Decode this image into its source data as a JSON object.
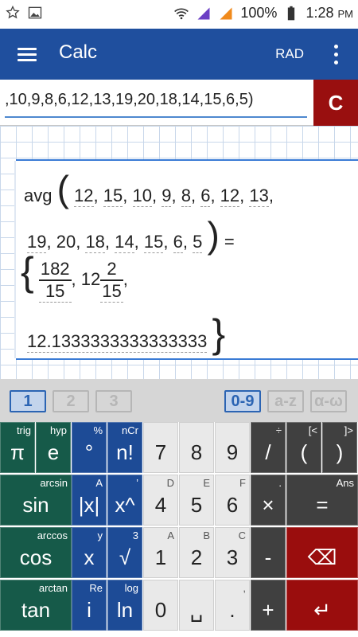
{
  "status": {
    "battery": "100%",
    "time": "1:28",
    "ampm": "PM"
  },
  "appbar": {
    "title": "Calc",
    "mode": "RAD"
  },
  "input": {
    "expression": ",10,9,8,6,12,13,19,20,18,14,15,6,5)",
    "clear_label": "C"
  },
  "result": {
    "func": "avg",
    "line1": [
      "12",
      "15",
      "10",
      "9",
      "8",
      "6",
      "12",
      "13"
    ],
    "line2": [
      "19",
      "20",
      "18",
      "14",
      "15",
      "6",
      "5"
    ],
    "equals": "=",
    "frac1_num": "182",
    "frac1_den": "15",
    "mixed_whole": "12",
    "mixed_num": "2",
    "mixed_den": "15",
    "decimal": "12.1333333333333333"
  },
  "tabs": [
    "1",
    "2",
    "3",
    "0-9",
    "a-z",
    "α-ω"
  ],
  "keys": {
    "row1": [
      {
        "label": "π",
        "sub": "trig"
      },
      {
        "label": "e",
        "sub": "hyp"
      },
      {
        "label": "°",
        "sub": "%"
      },
      {
        "label": "n!",
        "sub": "nCr"
      },
      {
        "label": "7",
        "sub": ""
      },
      {
        "label": "8",
        "sub": ""
      },
      {
        "label": "9",
        "sub": ""
      },
      {
        "label": "/",
        "sub": "÷"
      },
      {
        "label": "(",
        "sub": "[<"
      },
      {
        "label": ")",
        "sub": "]>"
      }
    ],
    "row2": [
      {
        "label": "sin",
        "sub": "arcsin"
      },
      {
        "label": "|x|",
        "sub": "A"
      },
      {
        "label": "x^",
        "sub": "’"
      },
      {
        "label": "4",
        "sub": "D"
      },
      {
        "label": "5",
        "sub": "E"
      },
      {
        "label": "6",
        "sub": "F"
      },
      {
        "label": "×",
        "sub": "."
      },
      {
        "label": "=",
        "sub": "Ans"
      }
    ],
    "row3": [
      {
        "label": "cos",
        "sub": "arccos"
      },
      {
        "label": "x",
        "sub": "y"
      },
      {
        "label": "√",
        "sub": "3"
      },
      {
        "label": "1",
        "sub": "A"
      },
      {
        "label": "2",
        "sub": "B"
      },
      {
        "label": "3",
        "sub": "C"
      },
      {
        "label": "-",
        "sub": ""
      },
      {
        "label": "⌫",
        "sub": ""
      }
    ],
    "row4": [
      {
        "label": "tan",
        "sub": "arctan"
      },
      {
        "label": "i",
        "sub": "Re"
      },
      {
        "label": "ln",
        "sub": "log"
      },
      {
        "label": "0",
        "sub": ""
      },
      {
        "label": "␣",
        "sub": ""
      },
      {
        "label": ".",
        "sub": ","
      },
      {
        "label": "+",
        "sub": ""
      },
      {
        "label": "↵",
        "sub": ""
      }
    ]
  },
  "colors": {
    "appbar": "#1f4f9e",
    "clear": "#990f0f",
    "green_key": "#165a49",
    "blue_key": "#1d4b96",
    "dark_key": "#404040",
    "red_key": "#9a0d0d"
  }
}
